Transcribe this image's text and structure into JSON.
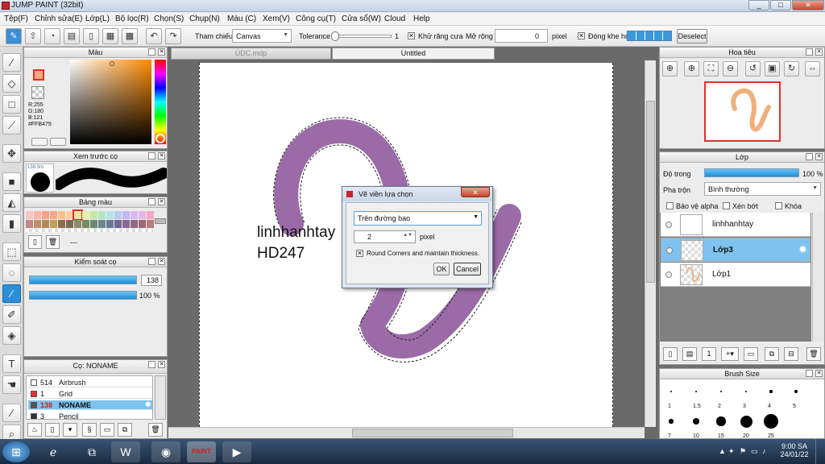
{
  "app": {
    "title": "JUMP PAINT (32bit)"
  },
  "window": {
    "minimize": "_",
    "maximize": "□",
    "close": "✕"
  },
  "menu": [
    "Tệp(F)",
    "Chỉnh sửa(E)",
    "Lớp(L)",
    "Bộ lọc(R)",
    "Chọn(S)",
    "Chụp(N)",
    "Màu (C)",
    "Xem(V)",
    "Công cụ(T)",
    "Cửa sổ(W)",
    "Cloud",
    "Help"
  ],
  "toolbar": {
    "ref_label": "Tham chiếu",
    "ref_value": "Canvas",
    "tolerance_label": "Tolerance",
    "tolerance_value": "1",
    "antialias_label": "Khử răng cưa",
    "expand_label": "Mở rộng",
    "expand_value": "0",
    "expand_unit": "pixel",
    "gap_label": "Đóng khe hở",
    "deselect": "Deselect"
  },
  "tabs": [
    "ÙDC.mdp",
    "Untitled"
  ],
  "color_panel": {
    "title": "Màu",
    "r": "R:255",
    "g": "G:180",
    "b": "B:121",
    "hex": "#FFB479",
    "fg": "#f4a88a"
  },
  "brush_preview": {
    "title": "Xem trước cọ",
    "size_label": "138.0m"
  },
  "palette": {
    "title": "Bảng màu",
    "footer": "---",
    "colors": [
      "#f7c7c4",
      "#f7b7a8",
      "#f4a18e",
      "#f3a78a",
      "#f9c28d",
      "#f8d0a4",
      "#f4e4a6",
      "#e7f0b0",
      "#c6e8a7",
      "#b5e6c4",
      "#b6e3ea",
      "#b5cdf1",
      "#c0b7f2",
      "#d9b8f1",
      "#e7b5e8",
      "#f0a8c8",
      "#c48686",
      "#c08e6e",
      "#b08a58",
      "#c29d5c",
      "#8c7048",
      "#7a6c50",
      "#8b8b6a",
      "#7b8a5e",
      "#6b8a72",
      "#6b8a8e",
      "#6b7896",
      "#74689a",
      "#866898",
      "#946884",
      "#9d6878",
      "#b87a7a"
    ]
  },
  "brush_control": {
    "title": "Kiểm soát cọ",
    "size": "138",
    "opacity": "100 %"
  },
  "brush_list": {
    "title": "Cọ: NONAME",
    "items": [
      {
        "num": "514",
        "name": "Airbrush",
        "color": "#ffffff"
      },
      {
        "num": "1",
        "name": "Grid",
        "color": "#e03030"
      },
      {
        "num": "138",
        "name": "NONAME",
        "color": "#555555"
      },
      {
        "num": "3",
        "name": "Pencil",
        "color": "#333333"
      }
    ]
  },
  "canvas": {
    "text1": "linhhanhtay",
    "text2": "HD247",
    "stroke_color": "#9b6ba8"
  },
  "dialog": {
    "title": "Vẽ viền lựa chọn",
    "mode": "Trên đường bao",
    "width_value": "2",
    "width_unit": "pixel",
    "round_label": "Round Corners and maintain thickness.",
    "ok": "OK",
    "cancel": "Cancel"
  },
  "navigator": {
    "title": "Hoa tiêu"
  },
  "layers": {
    "title": "Lớp",
    "opacity_label": "Độ trong",
    "opacity_value": "100 %",
    "blend_label": "Pha trộn",
    "blend_value": "Bình thường",
    "protect_alpha": "Bảo vệ alpha",
    "clip": "Xén bớt",
    "lock": "Khóa",
    "items": [
      {
        "name": "linhhanhtay",
        "selected": false
      },
      {
        "name": "Lớp3",
        "selected": true
      },
      {
        "name": "Lớp1",
        "selected": false
      }
    ]
  },
  "brush_size": {
    "title": "Brush Size",
    "labels_row1": [
      "1",
      "1.5",
      "2",
      "3",
      "4",
      "5"
    ],
    "labels_row2": [
      "7",
      "10",
      "15",
      "20",
      "25"
    ]
  },
  "taskbar": {
    "time": "9:00 SA",
    "date": "24/01/22"
  }
}
